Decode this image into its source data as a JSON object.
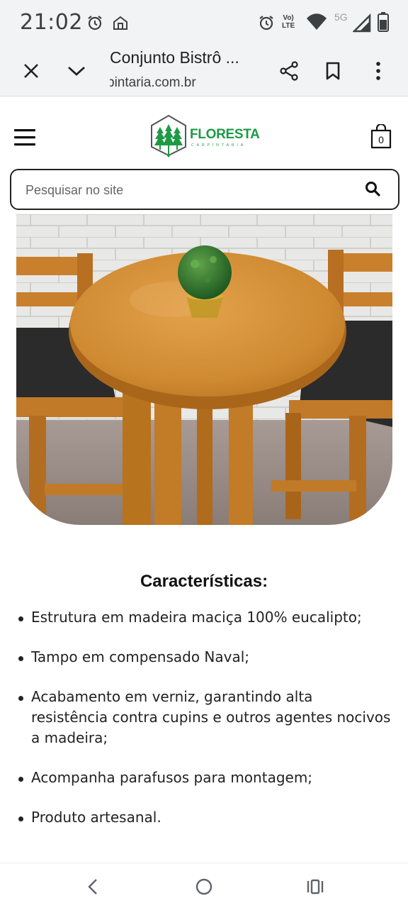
{
  "status_bar": {
    "time": "21:02",
    "volte_label_top": "Vo)",
    "volte_label_bottom": "LTE",
    "network_label": "5G"
  },
  "browser": {
    "page_title": "Conjunto Bistrô ...",
    "url": "pintaria.com.br"
  },
  "site": {
    "logo_name": "FLORESTA",
    "logo_subtitle": "CARPINTARIA",
    "cart_count": "0",
    "search_placeholder": "Pesquisar no site"
  },
  "content": {
    "features_heading": "Características",
    "features_heading_suffix": ":",
    "features": [
      "Estrutura em madeira maciça 100% eucalipto;",
      "Tampo em compensado Naval;",
      "Acabamento em verniz, garantindo alta resistência contra cupins e outros agentes nocivos a madeira;",
      "Acompanha parafusos para montagem;",
      "Produto artesanal."
    ]
  },
  "colors": {
    "brand_green": "#1e9a45",
    "chrome_bg": "#f1f3f4"
  }
}
